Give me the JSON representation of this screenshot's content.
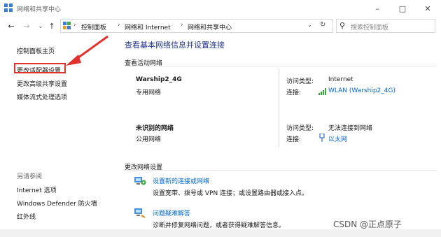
{
  "window": {
    "title": "网络和共享中心"
  },
  "address": {
    "crumbs": [
      "控制面板",
      "网络和 Internet",
      "网络和共享中心"
    ],
    "search_placeholder": "搜索控制面板"
  },
  "sidebar": {
    "home": "控制面板主页",
    "links": [
      "更改适配器设置",
      "更改高级共享设置",
      "媒体流式处理选项"
    ],
    "see_also_title": "另请参阅",
    "see_also": [
      "Internet 选项",
      "Windows Defender 防火墙",
      "红外线"
    ]
  },
  "main": {
    "heading": "查看基本网络信息并设置连接",
    "active_title": "查看活动网络",
    "networks": [
      {
        "name": "Warship2_4G",
        "type": "专用网络",
        "access_label": "访问类型:",
        "access_value": "Internet",
        "conn_label": "连接:",
        "conn_value": "WLAN (Warship2_4G)"
      },
      {
        "name": "未识别的网络",
        "type": "公用网络",
        "access_label": "访问类型:",
        "access_value": "无法连接到网络",
        "conn_label": "连接:",
        "conn_value": "以太网"
      }
    ],
    "change_title": "更改网络设置",
    "tasks": [
      {
        "title": "设置新的连接或网络",
        "desc": "设置宽带、拨号或 VPN 连接；或设置路由器或接入点。"
      },
      {
        "title": "问题疑难解答",
        "desc": "诊断并修复网络问题，或者获得疑难解答信息。"
      }
    ]
  },
  "watermark": "CSDN @正点原子",
  "colors": {
    "link": "#0066cc",
    "heading": "#1e3287",
    "highlight": "#e0322d"
  }
}
